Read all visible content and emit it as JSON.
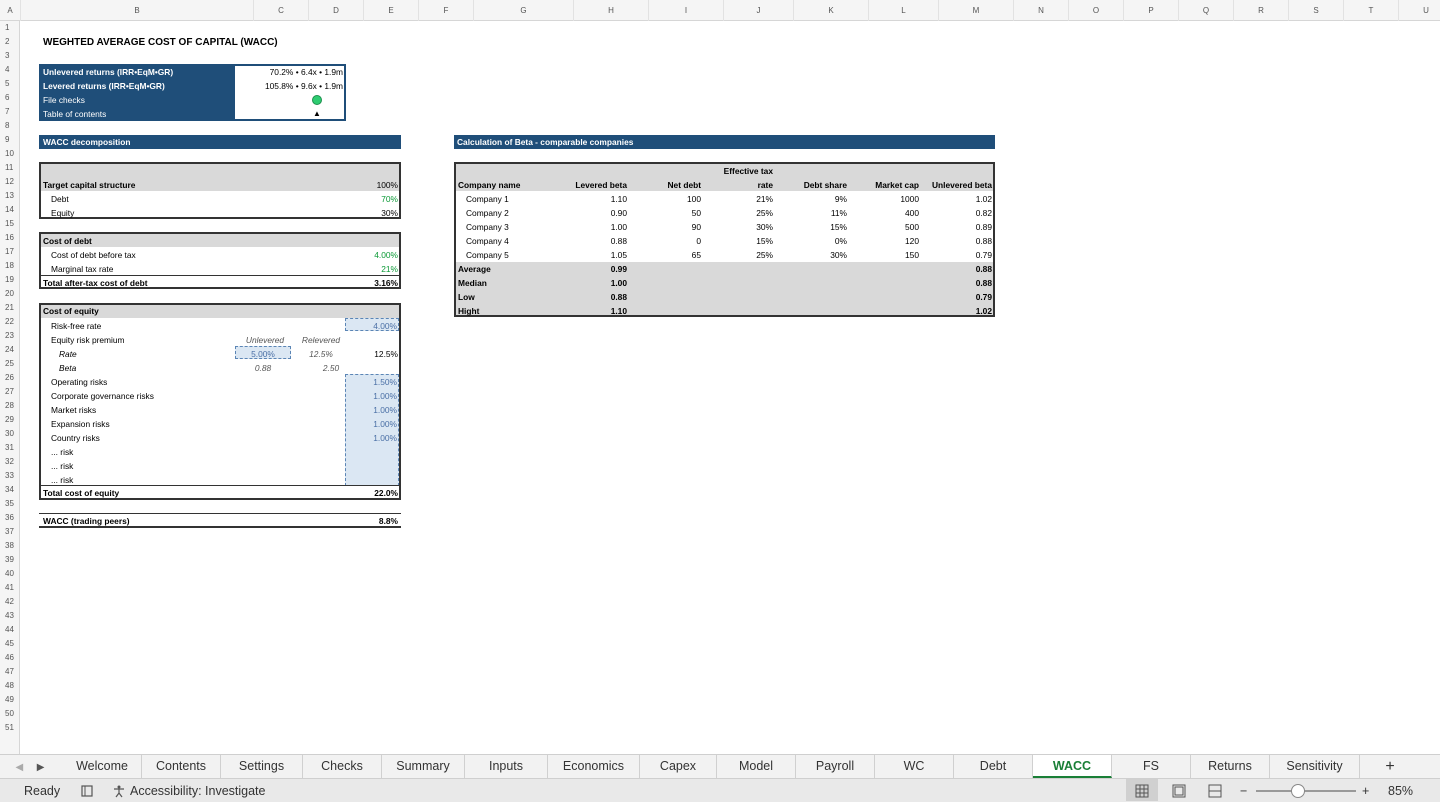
{
  "columns": [
    "A",
    "B",
    "C",
    "D",
    "E",
    "F",
    "G",
    "H",
    "I",
    "J",
    "K",
    "L",
    "M",
    "N",
    "O",
    "P",
    "Q",
    "R",
    "S",
    "T",
    "U"
  ],
  "rows": [
    "1",
    "2",
    "3",
    "4",
    "5",
    "6",
    "7",
    "8",
    "9",
    "10",
    "11",
    "12",
    "13",
    "14",
    "15",
    "16",
    "17",
    "18",
    "19",
    "20",
    "21",
    "22",
    "23",
    "24",
    "25",
    "26",
    "27",
    "28",
    "29",
    "30",
    "31",
    "32",
    "33",
    "34",
    "35",
    "36",
    "37",
    "38",
    "39",
    "40",
    "41",
    "42",
    "43",
    "44",
    "45",
    "46",
    "47",
    "48",
    "49",
    "50",
    "51"
  ],
  "title": "WEGHTED AVERAGE COST OF CAPITAL (WACC)",
  "summary": {
    "unlevered_label": "Unlevered returns (IRR•EqM•GR)",
    "unlevered_value": "70.2% • 6.4x • 1.9m",
    "levered_label": "Levered returns (IRR•EqM•GR)",
    "levered_value": "105.8% • 9.6x • 1.9m",
    "checks_label": "File checks",
    "toc_label": "Table of contents",
    "toc_symbol": "▲",
    "check_color": "#2ecc71"
  },
  "wacc": {
    "header": "WACC decomposition",
    "target_label": "Target capital structure",
    "target_value": "100%",
    "debt_label": "Debt",
    "debt_value": "70%",
    "equity_label": "Equity",
    "equity_value": "30%",
    "cod_label": "Cost of debt",
    "cod_before_label": "Cost of debt before tax",
    "cod_before_value": "4.00%",
    "tax_label": "Marginal tax rate",
    "tax_value": "21%",
    "cod_after_label": "Total after-tax cost of debt",
    "cod_after_value": "3.16%",
    "coe_label": "Cost of equity",
    "rf_label": "Risk-free rate",
    "rf_value": "4.00%",
    "erp_label": "Equity risk premium",
    "unlevered": "Unlevered",
    "relevered": "Relevered",
    "rate_label": "Rate",
    "rate_unlev": "5.00%",
    "rate_relev": "12.5%",
    "erp_value": "12.5%",
    "beta_label": "Beta",
    "beta_unlev": "0.88",
    "beta_relev": "2.50",
    "op_label": "Operating risks",
    "op_value": "1.50%",
    "cg_label": "Corporate governance risks",
    "cg_value": "1.00%",
    "mk_label": "Market risks",
    "mk_value": "1.00%",
    "ex_label": "Expansion risks",
    "ex_value": "1.00%",
    "cr_label": "Country risks",
    "cr_value": "1.00%",
    "risk_label": "... risk",
    "coe_total_label": "Total cost of equity",
    "coe_total_value": "22.0%",
    "wacc_label": "WACC (trading peers)",
    "wacc_value": "8.8%"
  },
  "beta": {
    "header": "Calculation of Beta - comparable companies",
    "col_company": "Company name",
    "col_levered": "Levered beta",
    "col_netdebt": "Net debt",
    "col_tax_top": "Effective tax",
    "col_tax_bottom": "rate",
    "col_debtshare": "Debt share",
    "col_mcap": "Market cap",
    "col_unlev": "Unlevered beta",
    "companies": [
      {
        "name": "Company 1",
        "levered": "1.10",
        "netdebt": "100",
        "tax": "21%",
        "debtshare": "9%",
        "mcap": "1000",
        "unlev": "1.02"
      },
      {
        "name": "Company 2",
        "levered": "0.90",
        "netdebt": "50",
        "tax": "25%",
        "debtshare": "11%",
        "mcap": "400",
        "unlev": "0.82"
      },
      {
        "name": "Company 3",
        "levered": "1.00",
        "netdebt": "90",
        "tax": "30%",
        "debtshare": "15%",
        "mcap": "500",
        "unlev": "0.89"
      },
      {
        "name": "Company 4",
        "levered": "0.88",
        "netdebt": "0",
        "tax": "15%",
        "debtshare": "0%",
        "mcap": "120",
        "unlev": "0.88"
      },
      {
        "name": "Company 5",
        "levered": "1.05",
        "netdebt": "65",
        "tax": "25%",
        "debtshare": "30%",
        "mcap": "150",
        "unlev": "0.79"
      }
    ],
    "stats": [
      {
        "name": "Average",
        "levered": "0.99",
        "unlev": "0.88"
      },
      {
        "name": "Median",
        "levered": "1.00",
        "unlev": "0.88"
      },
      {
        "name": "Low",
        "levered": "0.88",
        "unlev": "0.79"
      },
      {
        "name": "Hight",
        "levered": "1.10",
        "unlev": "1.02"
      }
    ]
  },
  "tabs": [
    "Welcome",
    "Contents",
    "Settings",
    "Checks",
    "Summary",
    "Inputs",
    "Economics",
    "Capex",
    "Model",
    "Payroll",
    "WC",
    "Debt",
    "WACC",
    "FS",
    "Returns",
    "Sensitivity"
  ],
  "active_tab": "WACC",
  "status": {
    "ready": "Ready",
    "accessibility": "Accessibility: Investigate",
    "zoom": "85%",
    "add_sheet": "+"
  }
}
